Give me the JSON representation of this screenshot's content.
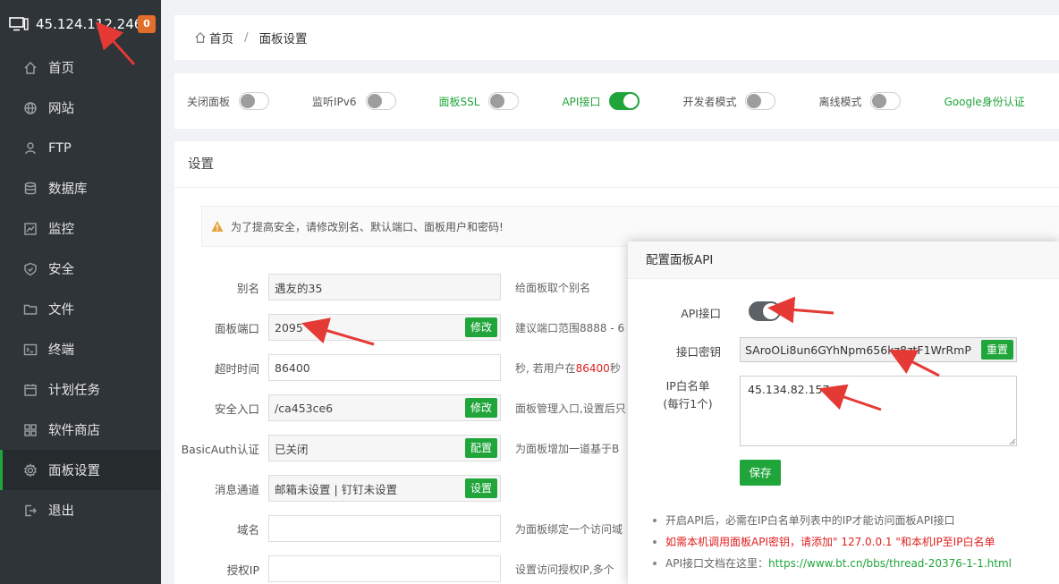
{
  "sidebar": {
    "host": "45.124.112.246",
    "badge": "0",
    "items": [
      {
        "label": "首页",
        "icon": "home-icon"
      },
      {
        "label": "网站",
        "icon": "globe-icon"
      },
      {
        "label": "FTP",
        "icon": "ftp-icon"
      },
      {
        "label": "数据库",
        "icon": "database-icon"
      },
      {
        "label": "监控",
        "icon": "monitor-chart-icon"
      },
      {
        "label": "安全",
        "icon": "shield-icon"
      },
      {
        "label": "文件",
        "icon": "folder-icon"
      },
      {
        "label": "终端",
        "icon": "terminal-icon"
      },
      {
        "label": "计划任务",
        "icon": "calendar-icon"
      },
      {
        "label": "软件商店",
        "icon": "apps-icon"
      },
      {
        "label": "面板设置",
        "icon": "gear-icon"
      },
      {
        "label": "退出",
        "icon": "logout-icon"
      }
    ]
  },
  "breadcrumb": {
    "home": "首页",
    "sep": "/",
    "current": "面板设置"
  },
  "toggles": [
    {
      "label": "关闭面板",
      "on": false
    },
    {
      "label": "监听IPv6",
      "on": false
    },
    {
      "label": "面板SSL",
      "on": false
    },
    {
      "label": "API接口",
      "on": true
    },
    {
      "label": "开发者模式",
      "on": false
    },
    {
      "label": "离线模式",
      "on": false
    },
    {
      "label": "Google身份认证"
    }
  ],
  "settings": {
    "title": "设置",
    "alert": "为了提高安全，请修改别名、默认端口、面板用户和密码!",
    "rows": [
      {
        "label": "别名",
        "value": "遇友的35",
        "button": "",
        "help": "给面板取个别名"
      },
      {
        "label": "面板端口",
        "value": "2095",
        "button": "修改",
        "help": "建议端口范围8888 - 6"
      },
      {
        "label": "超时时间",
        "value": "86400",
        "button": "",
        "help_pre": "秒, 若用户在",
        "help_red": "86400",
        "help_post": "秒"
      },
      {
        "label": "安全入口",
        "value": "/ca453ce6",
        "button": "修改",
        "help": "面板管理入口,设置后只"
      },
      {
        "label": "BasicAuth认证",
        "value": "已关闭",
        "button": "配置",
        "help": "为面板增加一道基于B"
      },
      {
        "label": "消息通道",
        "value": "邮箱未设置 | 钉钉未设置",
        "button": "设置",
        "help": ""
      },
      {
        "label": "域名",
        "value": "",
        "button": "",
        "help": "为面板绑定一个访问域"
      },
      {
        "label": "授权IP",
        "value": "",
        "button": "",
        "help": "设置访问授权IP,多个"
      }
    ]
  },
  "modal": {
    "title": "配置面板API",
    "api_label": "API接口",
    "api_on": true,
    "key_label": "接口密钥",
    "key_value": "SAroOLi8un6GYhNpm656kz8ztF1WrRmP",
    "reset": "重置",
    "ip_label": "IP白名单",
    "ip_label_sub": "(每行1个)",
    "ip_value": "45.134.82.157",
    "save": "保存",
    "notes": [
      {
        "text": "开启API后，必需在IP白名单列表中的IP才能访问面板API接口",
        "style": "normal"
      },
      {
        "text": "如需本机调用面板API密钥，请添加\" 127.0.0.1 \"和本机IP至IP白名单",
        "style": "red"
      },
      {
        "text_pre": "API接口文档在这里：",
        "link": "https://www.bt.cn/bbs/thread-20376-1-1.html",
        "style": "link"
      }
    ]
  },
  "colors": {
    "accent": "#20a53a",
    "sidebar": "#2f3438",
    "badge": "#e16e2b",
    "arrow": "#e53935"
  }
}
